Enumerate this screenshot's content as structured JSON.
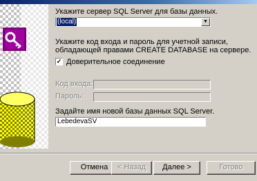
{
  "wizard": {
    "server_prompt": "Укажите сервер SQL Server для базы данных.",
    "server_value": "(local)",
    "login_prompt_line1": "Укажите код входа и пароль для учетной записи,",
    "login_prompt_line2": "обладающей правами CREATE DATABASE на сервере.",
    "trusted_label": "Доверительное соединение",
    "trusted_checked": true,
    "login_label": "Код входа:",
    "password_label": "Пароль:",
    "dbname_prompt": "Задайте имя новой базы данных SQL Server.",
    "dbname_value": "LebedevaSV"
  },
  "buttons": {
    "cancel": "Отмена",
    "back": "< Назад",
    "next": "Далее >",
    "finish": "Готово"
  },
  "icons": {
    "side": "access-key-icon",
    "dropdown": "chevron-down-icon",
    "check": "checkmark-icon"
  },
  "colors": {
    "dialog": "#d4d0c8",
    "selection": "#0a246a",
    "icon": "#800080"
  }
}
